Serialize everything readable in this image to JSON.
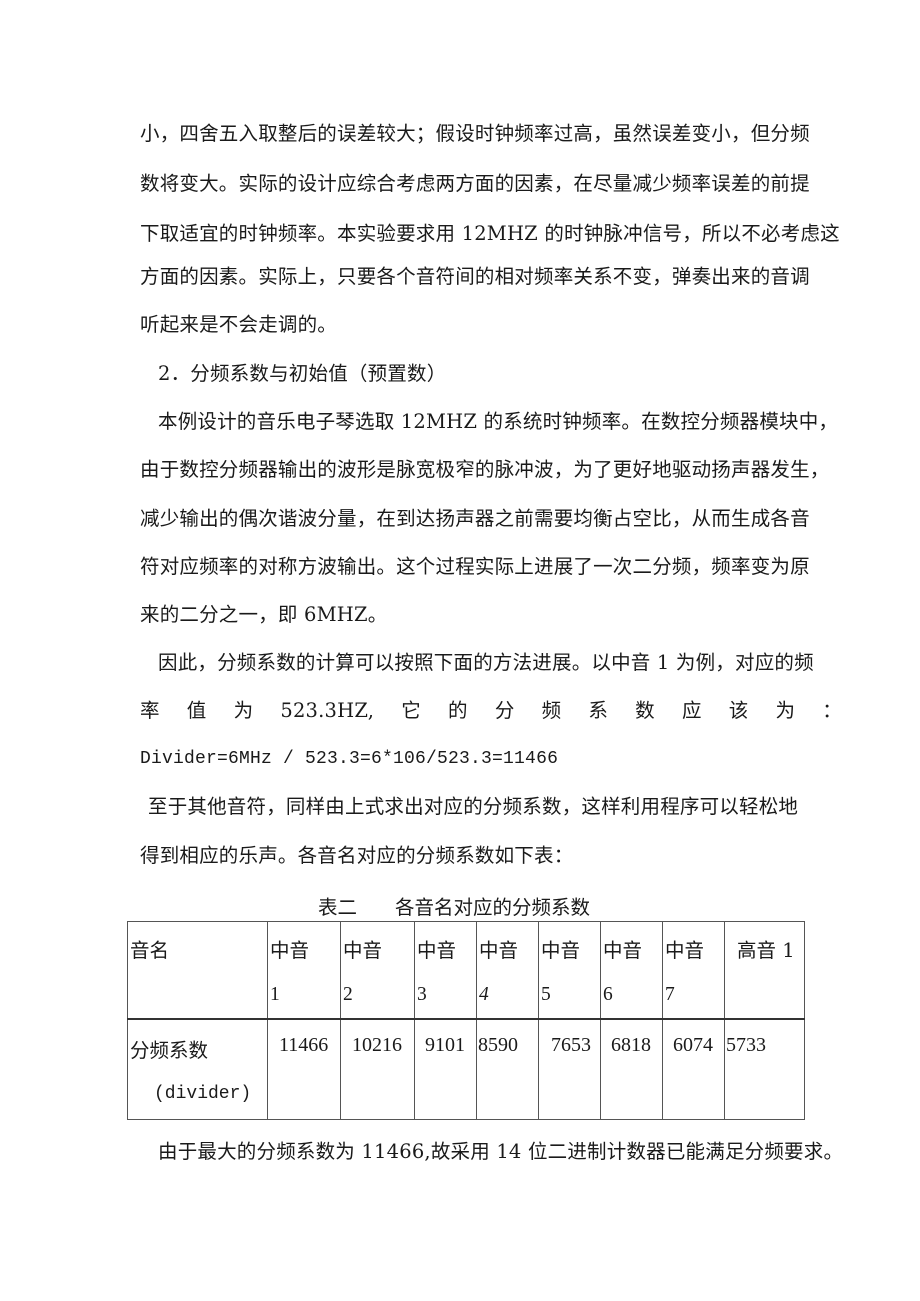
{
  "paragraphs": {
    "p1_lines": [
      "小，四舍五入取整后的误差较大；假设时钟频率过高，虽然误差变小，但分频",
      "数将变大。实际的设计应综合考虑两方面的因素，在尽量减少频率误差的前提",
      "下取适宜的时钟频率。本实验要求用 12MHZ 的时钟脉冲信号，所以不必考虑这",
      "方面的因素。实际上，只要各个音符间的相对频率关系不变，弹奏出来的音调",
      "听起来是不会走调的。"
    ],
    "section_heading": "2．分频系数与初始值（预置数）",
    "p2_lines": [
      "本例设计的音乐电子琴选取 12MHZ 的系统时钟频率。在数控分频器模块中，",
      "由于数控分频器输出的波形是脉宽极窄的脉冲波，为了更好地驱动扬声器发生，",
      "减少输出的偶次谐波分量，在到达扬声器之前需要均衡占空比，从而生成各音",
      "符对应频率的对称方波输出。这个过程实际上进展了一次二分频，频率变为原",
      "来的二分之一，即 6MHZ。"
    ],
    "p3_line1": "因此，分频系数的计算可以按照下面的方法进展。以中音 1 为例，对应的频",
    "p3_line2_words": [
      "率",
      "值",
      "为",
      "523.3HZ,",
      "它",
      "的",
      "分",
      "频",
      "系",
      "数",
      "应",
      "该",
      "为",
      "："
    ],
    "formula": "Divider=6MHz / 523.3=6*106/523.3=11466",
    "p4_lines": [
      "至于其他音符，同样由上式求出对应的分频系数，这样利用程序可以轻松地",
      "得到相应的乐声。各音名对应的分频系数如下表："
    ],
    "conclusion": "由于最大的分频系数为 11466,故采用 14 位二进制计数器已能满足分频要求。"
  },
  "table": {
    "caption_number": "表二",
    "caption_title": "各音名对应的分频系数",
    "row_headers": {
      "name": "音名",
      "divider_cn": "分频系数",
      "divider_en": "(divider)"
    },
    "columns": [
      {
        "name_top": "中音",
        "name_bottom": "1",
        "divider": "11466"
      },
      {
        "name_top": "中音",
        "name_bottom": "2",
        "divider": "10216"
      },
      {
        "name_top": "中音",
        "name_bottom": "3",
        "divider": "9101"
      },
      {
        "name_top": "中音",
        "name_bottom": "4",
        "divider": "8590"
      },
      {
        "name_top": "中音",
        "name_bottom": "5",
        "divider": "7653"
      },
      {
        "name_top": "中音",
        "name_bottom": "6",
        "divider": "6818"
      },
      {
        "name_top": "中音",
        "name_bottom": "7",
        "divider": "6074"
      },
      {
        "name_top": "高音 1",
        "name_bottom": "",
        "divider": "5733"
      }
    ]
  }
}
